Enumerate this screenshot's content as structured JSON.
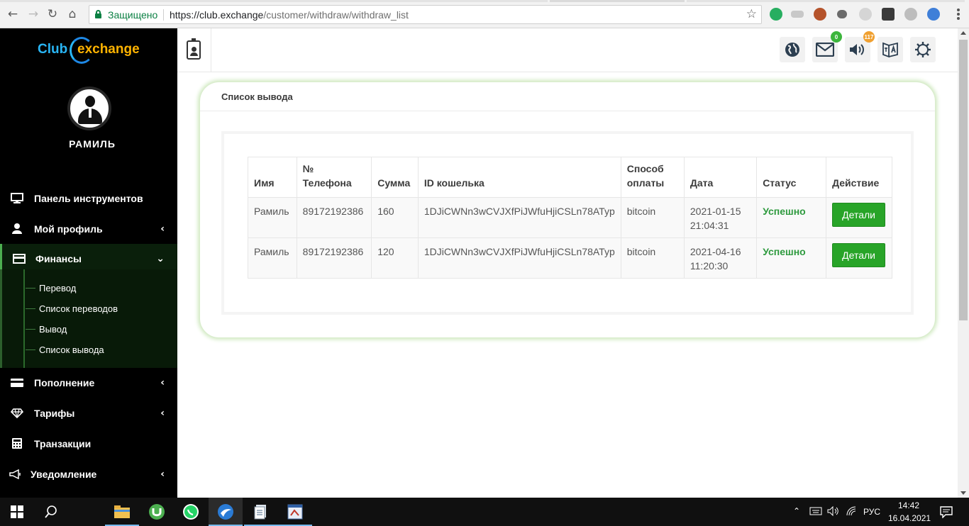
{
  "browser": {
    "secure_label": "Защищено",
    "url_host": "https://club.exchange",
    "url_path": "/customer/withdraw/withdraw_list"
  },
  "sidebar": {
    "logo_left": "Club",
    "logo_right": "exchange",
    "username": "РАМИЛЬ",
    "items": [
      {
        "label": "Панель инструментов",
        "icon": "monitor-icon"
      },
      {
        "label": "Мой профиль",
        "icon": "user-icon"
      },
      {
        "label": "Финансы",
        "icon": "credit-card-icon"
      },
      {
        "label": "Пополнение",
        "icon": "card-icon"
      },
      {
        "label": "Тарифы",
        "icon": "diamond-icon"
      },
      {
        "label": "Транзакции",
        "icon": "calculator-icon"
      },
      {
        "label": "Уведомление",
        "icon": "megaphone-icon"
      }
    ],
    "finance_submenu": [
      "Перевод",
      "Список переводов",
      "Вывод",
      "Список вывода"
    ]
  },
  "header": {
    "mail_badge": "0",
    "sound_badge": "117"
  },
  "page": {
    "title": "Список вывода"
  },
  "table": {
    "columns": [
      "Имя",
      "№ Телефона",
      "Сумма",
      "ID кошелька",
      "Способ оплаты",
      "Дата",
      "Статус",
      "Действие"
    ],
    "rows": [
      {
        "name": "Рамиль",
        "phone": "89172192386",
        "amount": "160",
        "wallet": "1DJiCWNn3wCVJXfPiJWfuHjiCSLn78ATyp",
        "method": "bitcoin",
        "date": "2021-01-15",
        "time": "21:04:31",
        "status": "Успешно",
        "action": "Детали"
      },
      {
        "name": "Рамиль",
        "phone": "89172192386",
        "amount": "120",
        "wallet": "1DJiCWNn3wCVJXfPiJWfuHjiCSLn78ATyp",
        "method": "bitcoin",
        "date": "2021-04-16",
        "time": "11:20:30",
        "status": "Успешно",
        "action": "Детали"
      }
    ]
  },
  "taskbar": {
    "lang": "РУС",
    "time": "14:42",
    "date": "16.04.2021"
  },
  "colors": {
    "accent_green": "#28a428",
    "sidebar_bg": "#000000",
    "status_green": "#2e9a3e"
  }
}
